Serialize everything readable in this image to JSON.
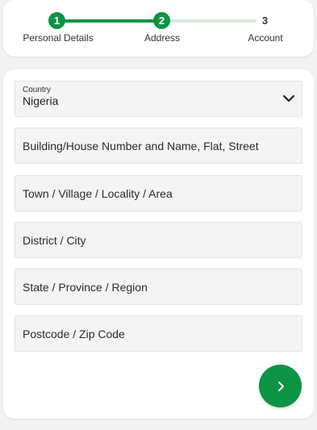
{
  "stepper": {
    "steps": [
      {
        "number": "1",
        "label": "Personal Details",
        "state": "done"
      },
      {
        "number": "2",
        "label": "Address",
        "state": "done"
      },
      {
        "number": "3",
        "label": "Account",
        "state": "upcoming"
      }
    ],
    "accent_color": "#0b9443"
  },
  "form": {
    "country": {
      "label": "Country",
      "value": "Nigeria"
    },
    "building": {
      "placeholder": "Building/House Number and Name, Flat, Street",
      "value": ""
    },
    "town": {
      "placeholder": "Town / Village / Locality / Area",
      "value": ""
    },
    "district": {
      "placeholder": "District / City",
      "value": ""
    },
    "state": {
      "placeholder": "State / Province / Region",
      "value": ""
    },
    "postcode": {
      "placeholder": "Postcode / Zip Code",
      "value": ""
    },
    "next_button_icon": "chevron-right-icon"
  }
}
